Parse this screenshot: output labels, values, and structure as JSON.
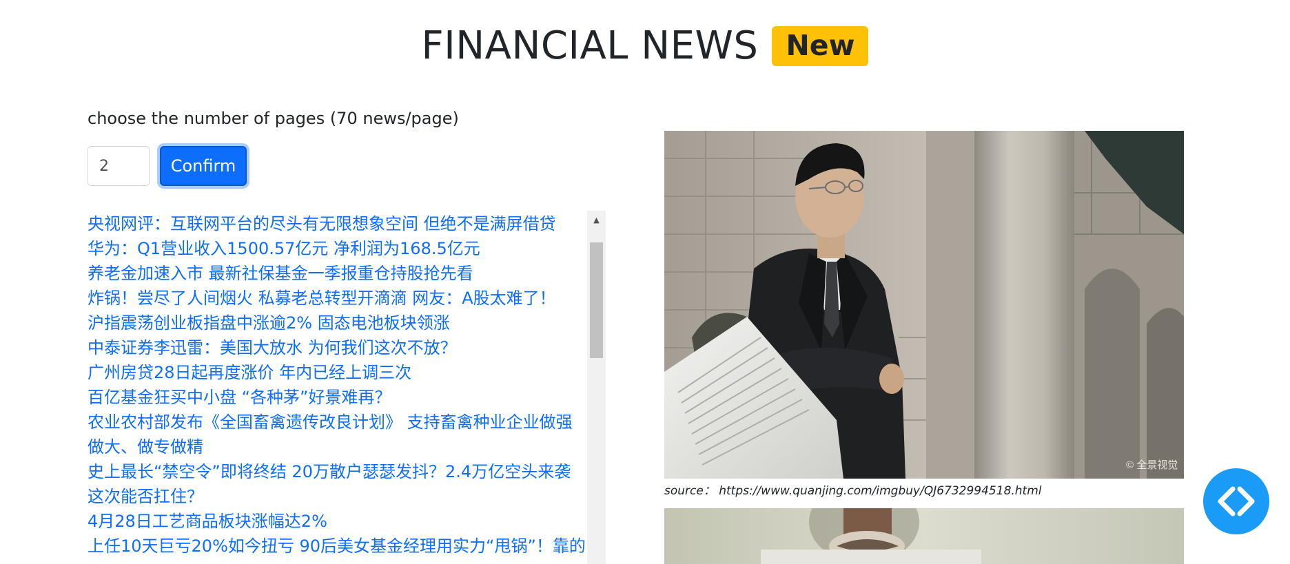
{
  "header": {
    "title": "FINANCIAL NEWS",
    "badge": "New"
  },
  "controls": {
    "pages_label": "choose the number of pages (70 news/page)",
    "pages_value": "2",
    "confirm_label": "Confirm"
  },
  "news": [
    "央视网评：互联网平台的尽头有无限想象空间 但绝不是满屏借贷",
    "华为：Q1营业收入1500.57亿元 净利润为168.5亿元",
    "养老金加速入市 最新社保基金一季报重仓持股抢先看",
    "炸锅！尝尽了人间烟火 私募老总转型开滴滴 网友：A股太难了！",
    "沪指震荡创业板指盘中涨逾2% 固态电池板块领涨",
    "中泰证券李迅雷：美国大放水 为何我们这次不放？",
    "广州房贷28日起再度涨价 年内已经上调三次",
    "百亿基金狂买中小盘 “各种茅”好景难再？",
    "农业农村部发布《全国畜禽遗传改良计划》 支持畜禽种业企业做强做大、做专做精",
    "史上最长“禁空令”即将终结 20万散户瑟瑟发抖？2.4万亿空头来袭 这次能否扛住？",
    "4月28日工艺商品板块涨幅达2%",
    "上任10天巨亏20%如今扭亏 90后美女基金经理用实力“甩锅”！靠的"
  ],
  "image": {
    "source_caption": "source： https://www.quanjing.com/imgbuy/QJ6732994518.html",
    "watermark": "© 全景视觉"
  },
  "colors": {
    "link": "#0d6efd",
    "badge": "#ffc107",
    "button": "#0d6efd",
    "fab": "#1a9bf5"
  },
  "icons": {
    "fab": "code-brackets-icon"
  }
}
